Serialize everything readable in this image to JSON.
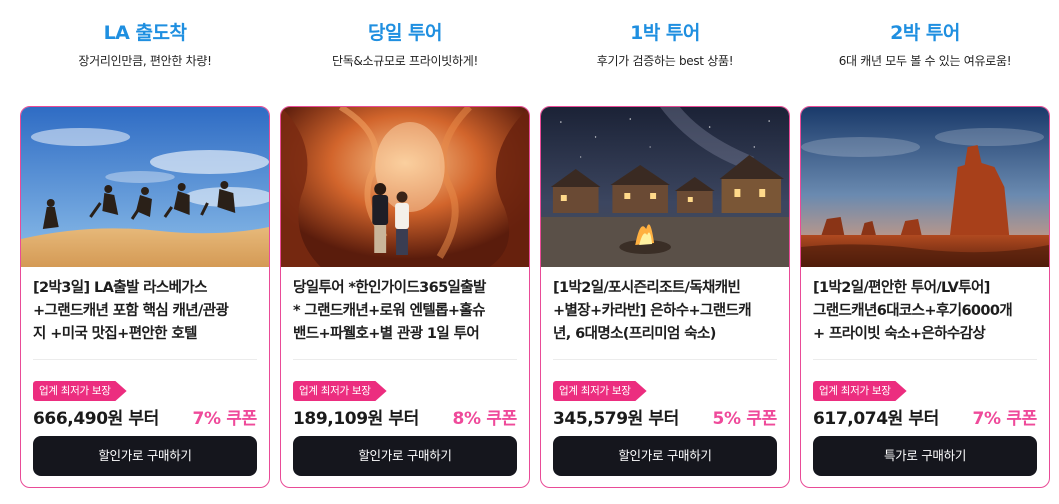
{
  "products": [
    {
      "category_title": "LA 출도착",
      "category_sub": "장거리인만큼, 편안한 차량!",
      "title": "[2박3일] LA출발 라스베가스\n+그랜드캐년 포함 핵심 캐년/관광\n지 +미국 맛집+편안한 호텔",
      "badge": "업계 최저가 보장",
      "price": "666,490원 부터",
      "coupon": "7% 쿠폰",
      "button": "할인가로 구매하기"
    },
    {
      "category_title": "당일 투어",
      "category_sub": "단독&소규모로 프라이빗하게!",
      "title": "당일투어 *한인가이드365일출발\n* 그랜드캐년+로워 엔텔롭+홀슈\n밴드+파웰호+별 관광 1일 투어",
      "badge": "업계 최저가 보장",
      "price": "189,109원 부터",
      "coupon": "8% 쿠폰",
      "button": "할인가로 구매하기"
    },
    {
      "category_title": "1박 투어",
      "category_sub": "후기가 검증하는 best 상품!",
      "title": "[1박2일/포시즌리조트/독채캐빈\n+별장+카라반] 은하수+그랜드캐\n년, 6대명소(프리미엄 숙소)",
      "badge": "업계 최저가 보장",
      "price": "345,579원 부터",
      "coupon": "5% 쿠폰",
      "button": "할인가로 구매하기"
    },
    {
      "category_title": "2박 투어",
      "category_sub": "6대 캐년 모두 볼 수 있는 여유로움!",
      "title": "[1박2일/편안한 투어/LV투어]\n그랜드캐년6대코스+후기6000개\n+ 프라이빗 숙소+은하수감상",
      "badge": "업계 최저가 보장",
      "price": "617,074원 부터",
      "coupon": "7% 쿠폰",
      "button": "특가로 구매하기"
    }
  ]
}
